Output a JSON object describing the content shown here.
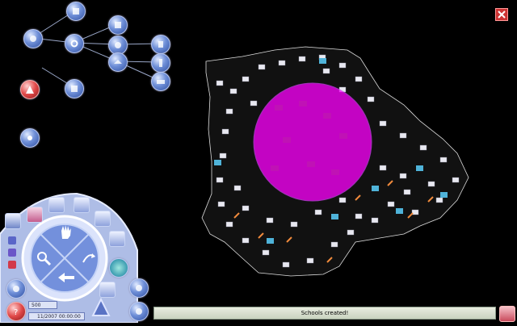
{
  "status": {
    "message": "Schools created!"
  },
  "controls": {
    "scale_value": "500",
    "date_value": "11/2007 00:00:00"
  },
  "icons": {
    "tree": [
      "network-icon",
      "globe-icon",
      "gear-icon",
      "disk-icon",
      "camera-icon",
      "building-icon",
      "map-icon",
      "phone-icon",
      "database-icon",
      "grid-icon",
      "warning-icon",
      "sun-icon"
    ],
    "panel": [
      "hand-icon",
      "magnify-icon",
      "refresh-icon",
      "arrow-left-icon",
      "money-icon",
      "help-icon"
    ]
  },
  "colors": {
    "map_fill": "#000000",
    "highlight": "#ff00ff",
    "status_bg": "#dfe6d6",
    "accent": "#4a6fd0"
  }
}
